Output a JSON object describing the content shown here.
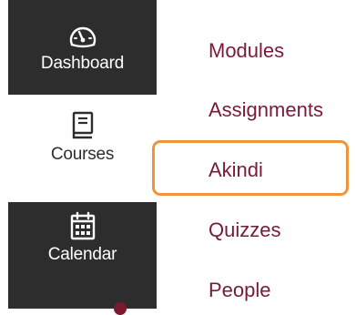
{
  "global_nav": {
    "items": [
      {
        "label": "Dashboard",
        "icon": "dashboard-icon"
      },
      {
        "label": "Courses",
        "icon": "book-icon"
      },
      {
        "label": "Calendar",
        "icon": "calendar-icon"
      }
    ]
  },
  "course_nav": {
    "links": [
      {
        "label": "Modules"
      },
      {
        "label": "Assignments"
      },
      {
        "label": "Akindi"
      },
      {
        "label": "Quizzes"
      },
      {
        "label": "People"
      }
    ]
  },
  "colors": {
    "nav_background": "#2d2d2d",
    "link_color": "#7a1a3a",
    "highlight": "#f0943a"
  }
}
